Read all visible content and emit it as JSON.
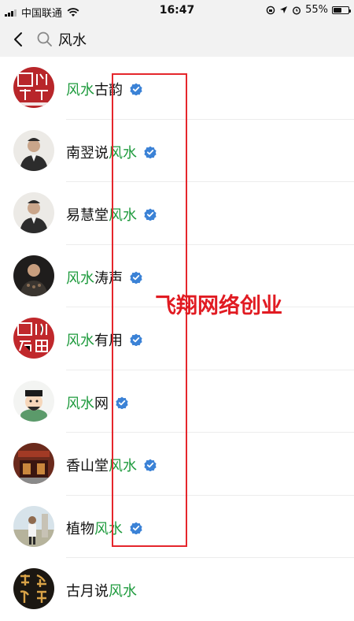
{
  "status_bar": {
    "carrier": "中国联通",
    "time": "16:47",
    "battery_percent": "55%",
    "battery_level": 0.55,
    "icons": [
      "signal-icon",
      "wifi-icon",
      "location-lock-icon",
      "location-arrow-icon",
      "alarm-icon",
      "battery-icon"
    ]
  },
  "search": {
    "query": "风水"
  },
  "results": [
    {
      "parts": [
        {
          "t": "风水",
          "hl": true
        },
        {
          "t": "古韵",
          "hl": false
        }
      ],
      "verified": true,
      "avatar": "seal-red-guyun"
    },
    {
      "parts": [
        {
          "t": "南翌说",
          "hl": false
        },
        {
          "t": "风水",
          "hl": true
        }
      ],
      "verified": true,
      "avatar": "man-photo"
    },
    {
      "parts": [
        {
          "t": "易慧堂",
          "hl": false
        },
        {
          "t": "风水",
          "hl": true
        }
      ],
      "verified": true,
      "avatar": "man-photo"
    },
    {
      "parts": [
        {
          "t": "风水",
          "hl": true
        },
        {
          "t": "涛声",
          "hl": false
        }
      ],
      "verified": true,
      "avatar": "man-photo-dark"
    },
    {
      "parts": [
        {
          "t": "风水",
          "hl": true
        },
        {
          "t": "有用",
          "hl": false
        }
      ],
      "verified": true,
      "avatar": "seal-red-youyong"
    },
    {
      "parts": [
        {
          "t": "风水",
          "hl": true
        },
        {
          "t": "网",
          "hl": false
        }
      ],
      "verified": true,
      "avatar": "cartoon-master"
    },
    {
      "parts": [
        {
          "t": "香山堂",
          "hl": false
        },
        {
          "t": "风水",
          "hl": true
        }
      ],
      "verified": true,
      "avatar": "storefront-photo"
    },
    {
      "parts": [
        {
          "t": "植物",
          "hl": false
        },
        {
          "t": "风水",
          "hl": true
        }
      ],
      "verified": true,
      "avatar": "man-outdoor-photo"
    },
    {
      "parts": [
        {
          "t": "古月说",
          "hl": false
        },
        {
          "t": "风水",
          "hl": true
        }
      ],
      "verified": false,
      "avatar": "calligraphy-logo"
    }
  ],
  "watermark": "飞翔网络创业",
  "colors": {
    "highlight": "#1f9b3e",
    "verified": "#3b82d6",
    "annotation": "#e5262c",
    "status_bg": "#f2f2f2"
  }
}
